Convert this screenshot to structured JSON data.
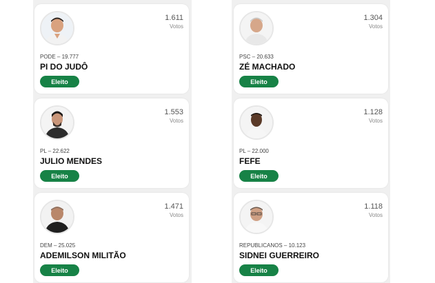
{
  "columns": [
    {
      "candidates": [
        {
          "votes": "1.611",
          "votes_label": "Votos",
          "party": "PODE – 19.777",
          "name": "PI DO JUDÔ",
          "status": "Eleito",
          "avatar": "candidate-photo"
        },
        {
          "votes": "1.553",
          "votes_label": "Votos",
          "party": "PL – 22.622",
          "name": "JULIO MENDES",
          "status": "Eleito",
          "avatar": "candidate-photo"
        },
        {
          "votes": "1.471",
          "votes_label": "Votos",
          "party": "DEM – 25.025",
          "name": "ADEMILSON MILITÃO",
          "status": "Eleito",
          "avatar": "candidate-photo"
        }
      ]
    },
    {
      "candidates": [
        {
          "votes": "1.304",
          "votes_label": "Votos",
          "party": "PSC – 20.633",
          "name": "ZÉ MACHADO",
          "status": "Eleito",
          "avatar": "candidate-photo"
        },
        {
          "votes": "1.128",
          "votes_label": "Votos",
          "party": "PL – 22.000",
          "name": "FEFE",
          "status": "Eleito",
          "avatar": "candidate-photo"
        },
        {
          "votes": "1.118",
          "votes_label": "Votos",
          "party": "REPUBLICANOS – 10.123",
          "name": "SIDNEI GUERREIRO",
          "status": "Eleito",
          "avatar": "candidate-photo"
        }
      ]
    }
  ],
  "colors": {
    "elected_badge": "#178246",
    "column_background": "#f0f0f0"
  }
}
